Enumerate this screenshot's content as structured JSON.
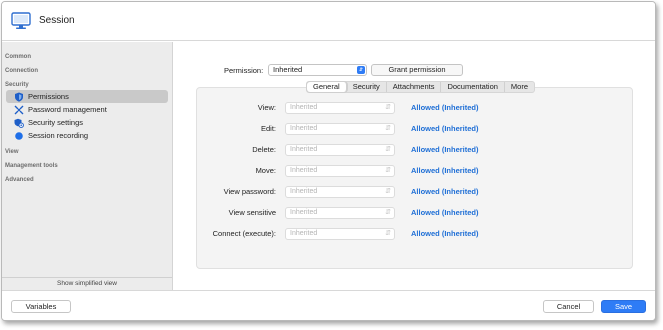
{
  "window": {
    "title": "Session",
    "title_icon": "monitor-icon"
  },
  "sidebar": {
    "sections": {
      "common": "Common",
      "connection": "Connection",
      "security": "Security",
      "view": "View",
      "management_tools": "Management tools",
      "advanced": "Advanced"
    },
    "items": [
      {
        "label": "Permissions",
        "icon": "shield-icon",
        "selected": true
      },
      {
        "label": "Password management",
        "icon": "key-arrows-icon",
        "selected": false
      },
      {
        "label": "Security settings",
        "icon": "security-settings-icon",
        "selected": false
      },
      {
        "label": "Session recording",
        "icon": "record-dot-icon",
        "selected": false
      }
    ],
    "footer_link": "Show simplified view"
  },
  "main": {
    "permission_label": "Permission:",
    "permission_value": "Inherited",
    "grant_button": "Grant permission",
    "tabs": [
      {
        "label": "General",
        "active": true
      },
      {
        "label": "Security",
        "active": false
      },
      {
        "label": "Attachments",
        "active": false
      },
      {
        "label": "Documentation",
        "active": false
      },
      {
        "label": "More",
        "active": false
      }
    ],
    "rows": [
      {
        "label": "View:",
        "value": "Inherited",
        "status": "Allowed (Inherited)"
      },
      {
        "label": "Edit:",
        "value": "Inherited",
        "status": "Allowed (Inherited)"
      },
      {
        "label": "Delete:",
        "value": "Inherited",
        "status": "Allowed (Inherited)"
      },
      {
        "label": "Move:",
        "value": "Inherited",
        "status": "Allowed (Inherited)"
      },
      {
        "label": "View password:",
        "value": "Inherited",
        "status": "Allowed (Inherited)"
      },
      {
        "label": "View sensitive",
        "value": "Inherited",
        "status": "Allowed (Inherited)"
      },
      {
        "label": "Connect (execute):",
        "value": "Inherited",
        "status": "Allowed (Inherited)"
      }
    ]
  },
  "footer": {
    "variables": "Variables",
    "cancel": "Cancel",
    "save": "Save"
  },
  "colors": {
    "accent": "#2e7cf6",
    "link": "#1f6fd6",
    "sidebar_bg": "#ececec",
    "selected_bg": "#c9c9c9"
  }
}
